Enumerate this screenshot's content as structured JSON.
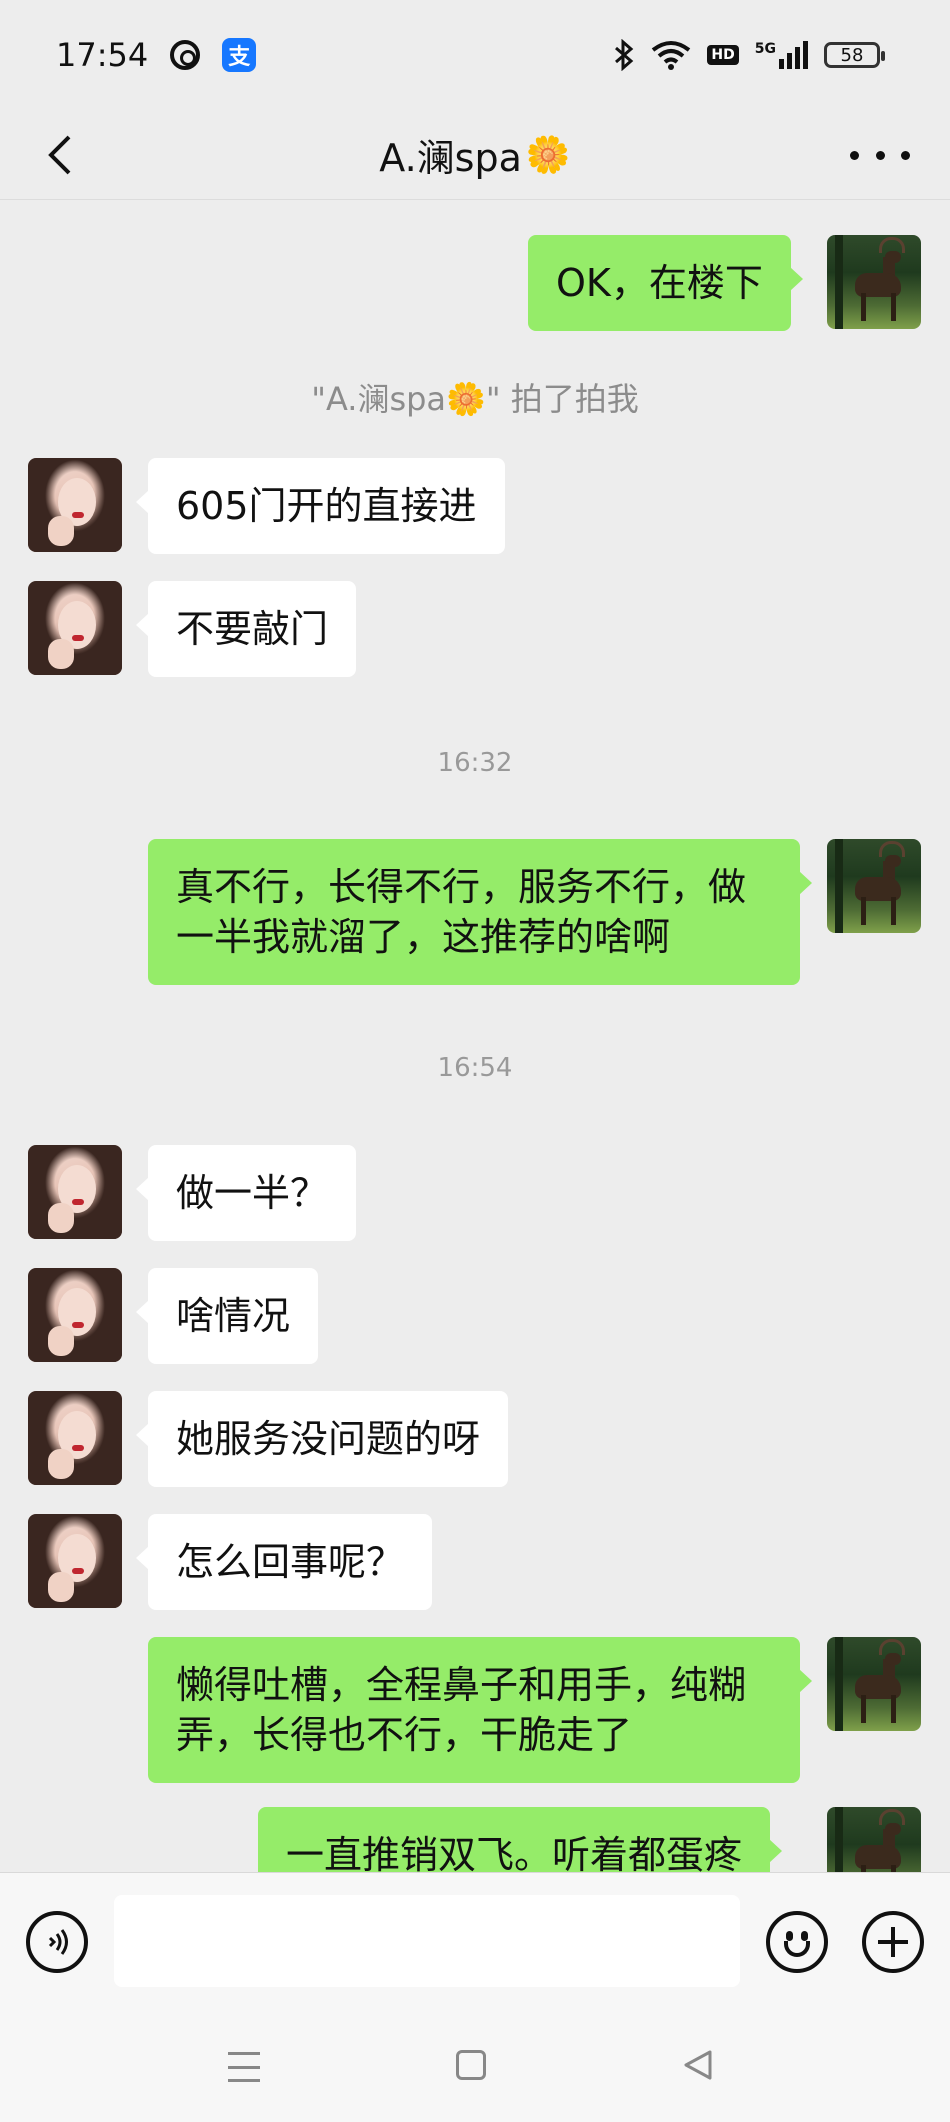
{
  "status_bar": {
    "time": "17:54",
    "network": "5G",
    "hd": "HD",
    "battery": "58",
    "icons": [
      "weibo-icon",
      "alipay-icon",
      "bluetooth-icon",
      "wifi-icon",
      "hd-icon",
      "signal-icon",
      "battery-icon"
    ]
  },
  "header": {
    "title": "A.澜spa",
    "title_emoji": "🌼"
  },
  "chat": {
    "messages": [
      {
        "type": "out",
        "text": "OK，在楼下",
        "avatar": "deer-avatar"
      },
      {
        "type": "system",
        "text": "\"A.澜spa🌼\" 拍了拍我"
      },
      {
        "type": "in",
        "text": "605门开的直接进",
        "avatar": "contact-avatar"
      },
      {
        "type": "in",
        "text": "不要敲门",
        "avatar": "contact-avatar"
      },
      {
        "type": "time",
        "text": "16:32"
      },
      {
        "type": "out",
        "text": "真不行，长得不行，服务不行，做一半我就溜了，这推荐的啥啊",
        "avatar": "deer-avatar"
      },
      {
        "type": "time",
        "text": "16:54"
      },
      {
        "type": "in",
        "text": "做一半？",
        "avatar": "contact-avatar"
      },
      {
        "type": "in",
        "text": "啥情况",
        "avatar": "contact-avatar"
      },
      {
        "type": "in",
        "text": "她服务没问题的呀",
        "avatar": "contact-avatar"
      },
      {
        "type": "in",
        "text": "怎么回事呢？",
        "avatar": "contact-avatar"
      },
      {
        "type": "out",
        "text": "懒得吐槽，全程鼻子和用手，纯糊弄，长得也不行，干脆走了",
        "avatar": "deer-avatar"
      },
      {
        "type": "out",
        "text": "一直推销双飞。听着都蛋疼",
        "avatar": "deer-avatar"
      }
    ]
  },
  "input_bar": {
    "value": "",
    "icons": [
      "voice-icon",
      "emoji-icon",
      "plus-icon"
    ]
  },
  "nav_bar": {
    "icons": [
      "menu-icon",
      "home-icon",
      "back-triangle-icon"
    ]
  },
  "colors": {
    "background": "#ededed",
    "outgoing_bubble": "#95ec69",
    "incoming_bubble": "#ffffff",
    "system_text": "#8c8c8c"
  }
}
